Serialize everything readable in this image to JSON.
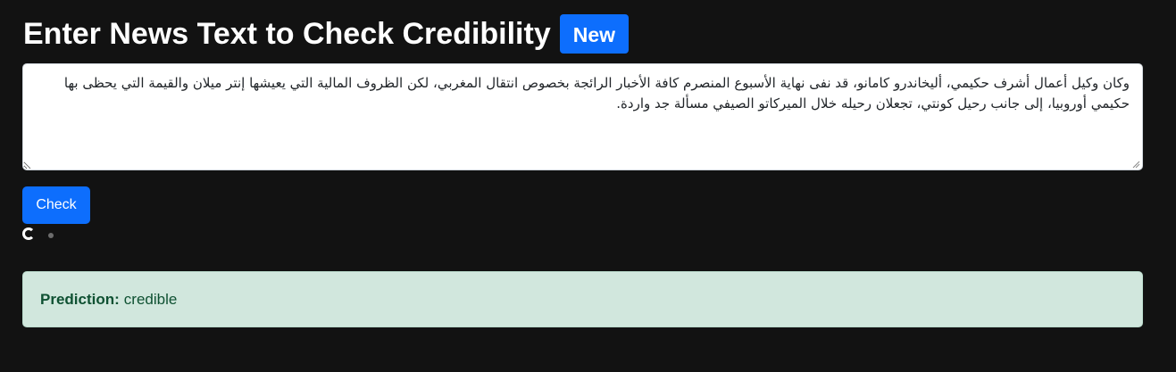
{
  "header": {
    "title": "Enter News Text to Check Credibility",
    "badge": "New"
  },
  "news_input": {
    "value": "وكان وكيل أعمال أشرف حكيمي، أليخاندرو كامانو، قد نفى نهاية الأسبوع المنصرم كافة الأخبار الرائجة بخصوص انتقال المغربي، لكن الظروف المالية التي يعيشها إنتر ميلان والقيمة التي يحظى بها حكيمي أوروبيا، إلى جانب رحيل كونتي، تجعلان رحيله خلال الميركاتو الصيفي مسألة جد واردة."
  },
  "actions": {
    "check_label": "Check"
  },
  "result": {
    "label": "Prediction:",
    "value": "credible"
  },
  "colors": {
    "background": "#121212",
    "primary": "#0d6efd",
    "success_bg": "#d1e7dd",
    "success_text": "#0f5132"
  }
}
